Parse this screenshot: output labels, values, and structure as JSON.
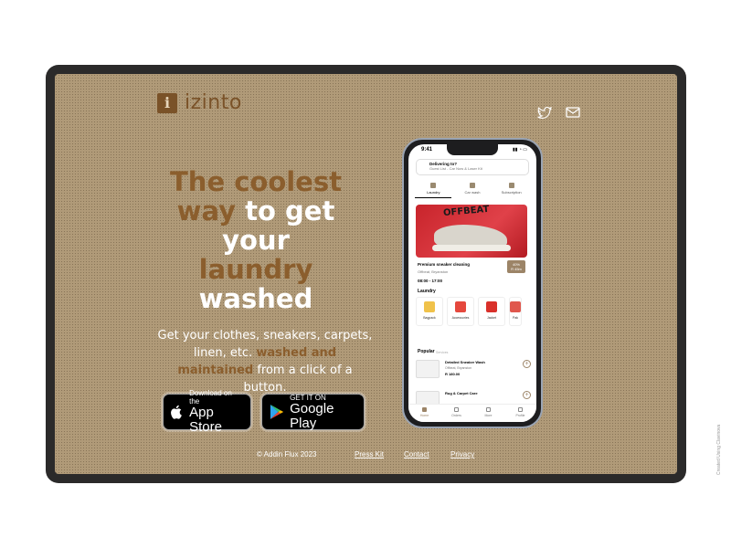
{
  "brand": {
    "logo_letter": "i",
    "name": "izinto"
  },
  "social": {
    "twitter_icon": "twitter-icon",
    "mail_icon": "mail-icon"
  },
  "hero": {
    "line1": "The coolest",
    "line2a": "way",
    "line2b": "to get",
    "line3": "your",
    "line4": "laundry",
    "line5": "washed"
  },
  "subtitle": {
    "part1": "Get your clothes, sneakers, carpets, linen, etc.",
    "accent": "washed and maintained",
    "part2": "from a click of a button."
  },
  "stores": {
    "appstore_small": "Download on the",
    "appstore_big": "App Store",
    "google_small": "GET IT ON",
    "google_big": "Google Play"
  },
  "footer": {
    "copyright": "© Addin Flux 2023",
    "press": "Press Kit",
    "contact": "Contact",
    "privacy": "Privacy"
  },
  "phone": {
    "time": "9:41",
    "deliver_title": "Delivering to?",
    "deliver_addr": "Guest List - Car Now & Laser Kit",
    "tabs": [
      "Laundry",
      "Car wash",
      "Subscription"
    ],
    "banner_brand": "OFFBEAT",
    "card_title": "Premium sneaker cleaning",
    "card_sub": "Offbeat, Bryanston",
    "card_time": "08:00 - 17:00",
    "price_line1": "40%",
    "price_line2": "R 45m",
    "laundry_heading": "Laundry",
    "categories": [
      "Bagpack",
      "Accessories",
      "Jacket",
      "Pak"
    ],
    "popular_heading": "Popular",
    "popular_sub": "Services",
    "items": [
      {
        "name": "Detailed Sneaker Wash",
        "loc": "Offbeat, Bryanston",
        "price": "R 180.00"
      },
      {
        "name": "Rug & Carpet Care",
        "loc": "",
        "price": ""
      }
    ],
    "nav": [
      "Home",
      "Orders",
      "More",
      "Profile"
    ]
  },
  "credit": "Created Using Clavinova",
  "colors": {
    "background": "#b09a78",
    "brown": "#8b5e2d",
    "frame": "#2b2a2a",
    "price_badge": "#9c8467"
  }
}
